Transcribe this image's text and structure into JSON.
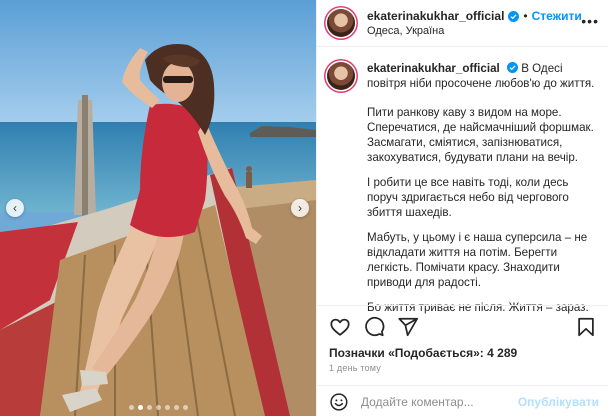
{
  "post": {
    "username": "ekaterinakukhar_official",
    "separator": "•",
    "follow_label": "Стежити",
    "location": "Одеса, Україна",
    "more_label": "•••"
  },
  "caption": {
    "username": "ekaterinakukhar_official",
    "paragraphs": [
      "В Одесі повітря ніби просочене любов'ю до життя.",
      "Пити ранкову каву з видом на море. Сперечатися, де найсмачніший форшмак. Засмагати, сміятися, запізнюватися, закохуватися, будувати плани на вечір.",
      "І робити це все навіть тоді, коли десь поруч здригається небо від чергового збиття шахедів.",
      "Мабуть, у цьому і є наша суперсила – не відкладати життя на потім. Берегти легкість. Помічати красу. Знаходити приводи для радості.",
      "Бо життя триває не після. Життя – зараз."
    ]
  },
  "engagement": {
    "likes_text": "Позначки «Подобається»: 4 289",
    "time_text": "1 день тому"
  },
  "comment": {
    "placeholder": "Додайте коментар...",
    "post_label": "Опублікувати"
  },
  "carousel": {
    "prev_symbol": "‹",
    "next_symbol": "›",
    "slide_count": 7,
    "active_index": 1
  },
  "icons": {
    "like": "heart-icon",
    "comment": "comment-icon",
    "share": "share-icon",
    "save": "bookmark-icon",
    "emoji": "emoji-icon",
    "verified": "verified-badge-icon"
  },
  "colors": {
    "accent": "#0095f6",
    "post_disabled": "#b2dffc",
    "muted": "#8e8e8e",
    "story_ring": "#e03b73"
  }
}
